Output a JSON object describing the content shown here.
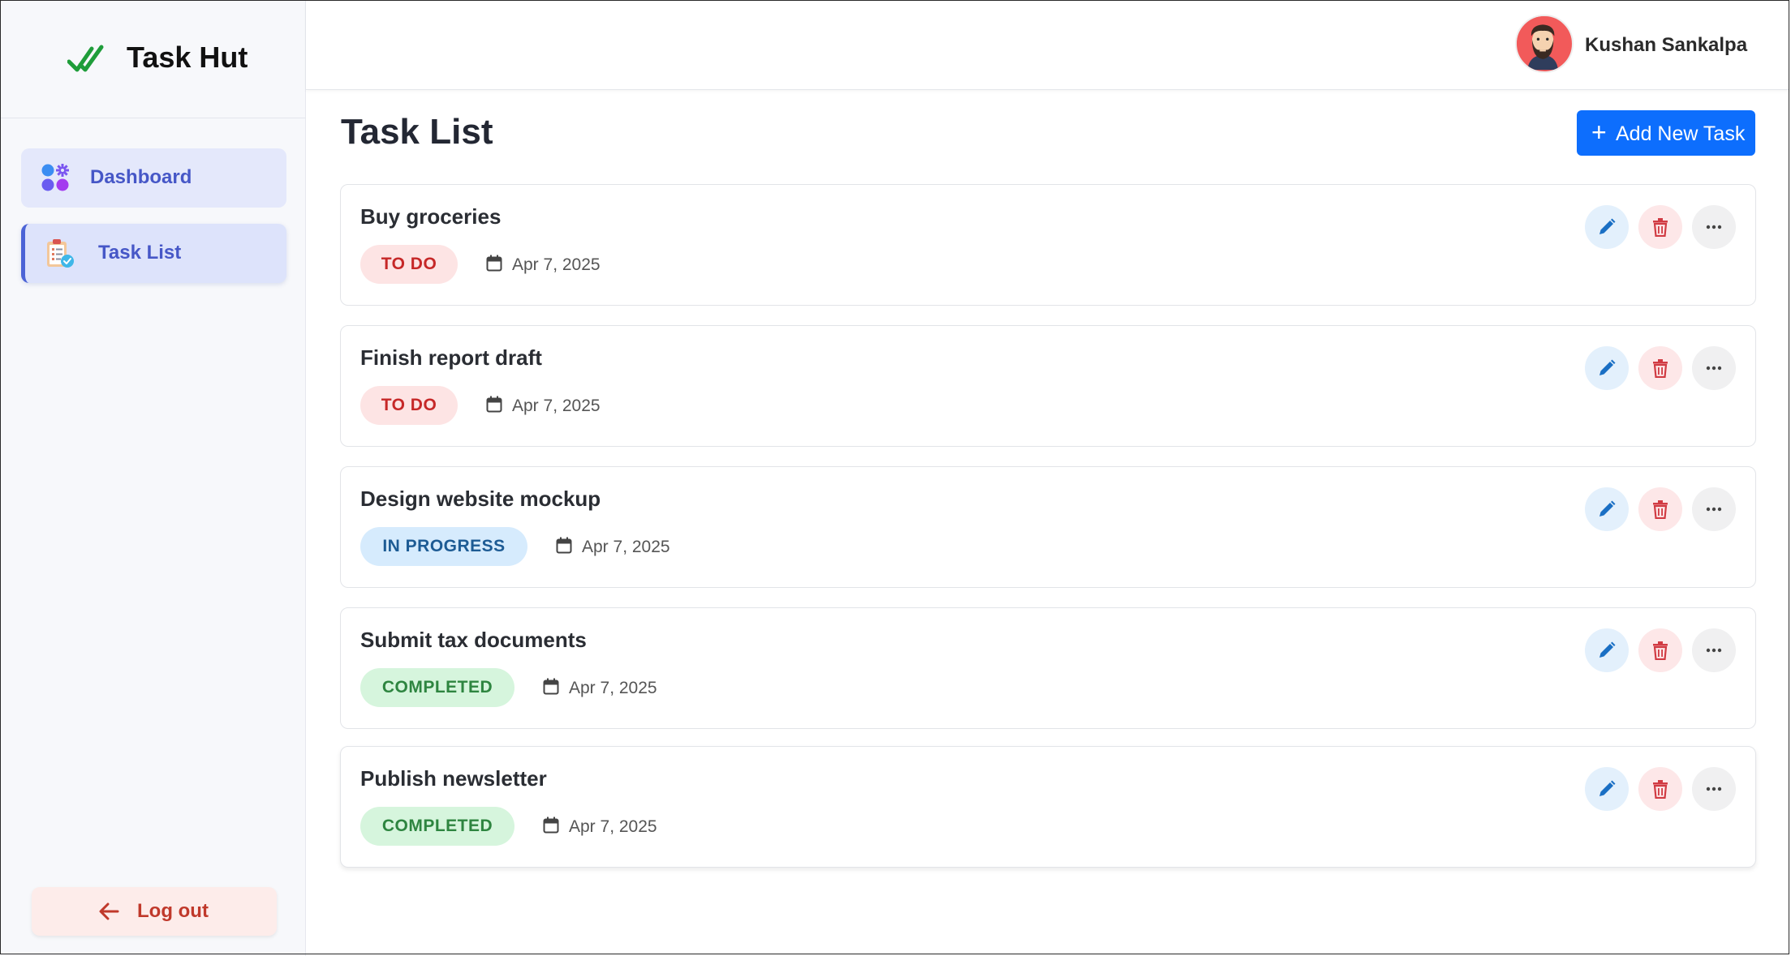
{
  "app": {
    "name": "Task Hut"
  },
  "sidebar": {
    "items": [
      {
        "label": "Dashboard",
        "icon": "dashboard-grid-icon"
      },
      {
        "label": "Task List",
        "icon": "clipboard-task-icon",
        "active": true
      }
    ],
    "logout_label": "Log out"
  },
  "header": {
    "user_name": "Kushan Sankalpa",
    "avatar_icon": "bearded-man-avatar"
  },
  "main": {
    "title": "Task List",
    "add_button_label": "Add New Task",
    "tasks": [
      {
        "title": "Buy groceries",
        "status": "TO DO",
        "date": "Apr 7, 2025"
      },
      {
        "title": "Finish report draft",
        "status": "TO DO",
        "date": "Apr 7, 2025"
      },
      {
        "title": "Design website mockup",
        "status": "IN PROGRESS",
        "date": "Apr 7, 2025"
      },
      {
        "title": "Submit tax documents",
        "status": "COMPLETED",
        "date": "Apr 7, 2025"
      },
      {
        "title": "Publish newsletter",
        "status": "COMPLETED",
        "date": "Apr 7, 2025"
      }
    ]
  },
  "colors": {
    "primary": "#0d6efd",
    "nav_accent": "#4b63d6",
    "todo": "#c62828",
    "in_progress": "#1d5b94",
    "completed": "#2e8540",
    "logout": "#c0392b"
  }
}
